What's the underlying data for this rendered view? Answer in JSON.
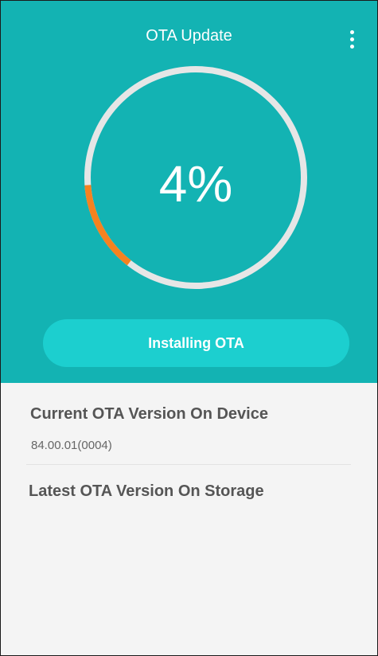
{
  "header": {
    "title": "OTA Update",
    "menu_icon": "more-vert-icon"
  },
  "progress": {
    "percent_label": "4%",
    "value": 0.04,
    "track_color": "#e6e6e6",
    "fill_color": "#f58220"
  },
  "action": {
    "label": "Installing OTA"
  },
  "info": {
    "current_title": "Current OTA Version On Device",
    "current_value": "84.00.01(0004)",
    "latest_title": "Latest OTA Version On Storage"
  },
  "colors": {
    "header_bg": "#13b3b3",
    "button_bg": "#1ccfcf",
    "content_bg": "#f4f4f4"
  }
}
